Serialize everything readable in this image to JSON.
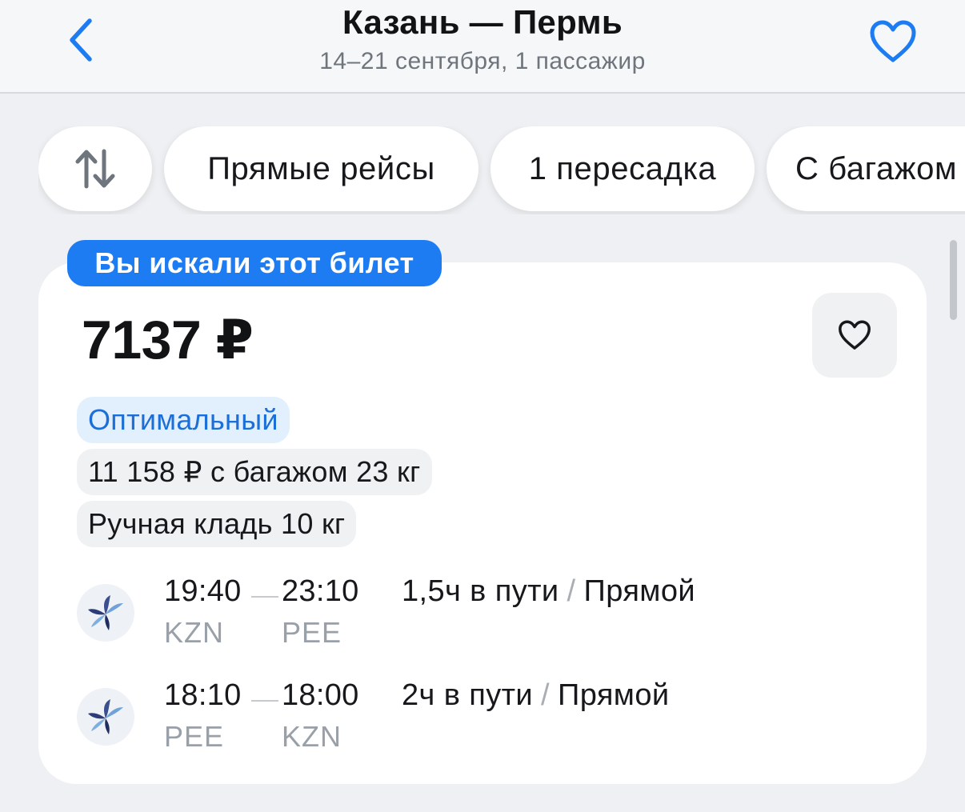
{
  "header": {
    "title": "Казань — Пермь",
    "subtitle": "14–21 сентября, 1 пассажир"
  },
  "filters": {
    "sort_icon": "sort-arrows-icon",
    "chips": [
      "Прямые рейсы",
      "1 пересадка",
      "С багажом"
    ]
  },
  "ticket": {
    "badge": "Вы искали этот билет",
    "price": "7137 ₽",
    "tags": {
      "optimal": "Оптимальный",
      "baggage": "11 158 ₽ с багажом 23 кг",
      "hand_luggage": "Ручная кладь 10 кг"
    },
    "segments": [
      {
        "dep_time": "19:40",
        "arr_time": "23:10",
        "dep_code": "KZN",
        "arr_code": "PEE",
        "duration": "1,5ч в пути",
        "type": "Прямой"
      },
      {
        "dep_time": "18:10",
        "arr_time": "18:00",
        "dep_code": "PEE",
        "arr_code": "KZN",
        "duration": "2ч в пути",
        "type": "Прямой"
      }
    ]
  },
  "colors": {
    "accent": "#1e7cf2",
    "background": "#eef0f3",
    "card": "#ffffff",
    "muted_text": "#9aa0a7"
  },
  "icons": [
    "back-chevron-icon",
    "heart-outline-icon",
    "sort-arrows-icon",
    "airline-bird-logo-icon"
  ]
}
